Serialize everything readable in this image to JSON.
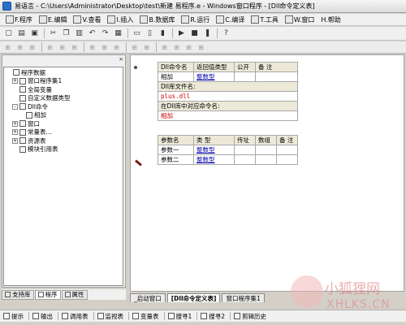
{
  "window": {
    "title": "易语言 - C:\\Users\\Administrator\\Desktop\\test\\新建 易程序.e - Windows窗口程序 - [Dll命令定义表]"
  },
  "menu": [
    {
      "label": "F.程序",
      "icon": "program-icon"
    },
    {
      "label": "E.编辑",
      "icon": "edit-icon"
    },
    {
      "label": "V.查看",
      "icon": "view-icon"
    },
    {
      "label": "I.插入",
      "icon": "insert-icon"
    },
    {
      "label": "B.数据库",
      "icon": "database-icon"
    },
    {
      "label": "R.运行",
      "icon": "run-icon"
    },
    {
      "label": "C.编译",
      "icon": "compile-icon"
    },
    {
      "label": "T.工具",
      "icon": "tools-icon"
    },
    {
      "label": "W.窗口",
      "icon": "window-icon"
    },
    {
      "label": "H.帮助",
      "icon": ""
    }
  ],
  "toolbar": {
    "buttons": [
      "new-file-icon",
      "open-folder-icon",
      "save-icon",
      "cut-icon",
      "copy-icon",
      "paste-icon",
      "undo-icon",
      "redo-icon",
      "find-icon",
      "window-layout-1-icon",
      "window-layout-2-icon",
      "window-layout-3-icon",
      "run-icon",
      "stop-icon",
      "debug-step-icon",
      "help-icon"
    ]
  },
  "toolbar2": {
    "buttons": [
      "align-left-icon",
      "align-center-icon",
      "align-right-icon",
      "align-top-icon",
      "align-middle-icon",
      "align-bottom-icon",
      "same-width-icon",
      "same-height-icon",
      "same-size-icon",
      "space-h-icon",
      "space-v-icon",
      "center-h-icon",
      "center-v-icon",
      "grid-icon",
      "lock-icon"
    ]
  },
  "left_panel": {
    "close_glyph": "×",
    "tree": [
      {
        "label": "程序数据",
        "indent": 0,
        "expander": "",
        "icon": "program-data-icon"
      },
      {
        "label": "窗口程序集1",
        "indent": 1,
        "expander": "+",
        "icon": "assembly-icon"
      },
      {
        "label": "全局变量",
        "indent": 1,
        "expander": "",
        "icon": "global-var-icon"
      },
      {
        "label": "自定义数据类型",
        "indent": 1,
        "expander": "",
        "icon": "custom-type-icon"
      },
      {
        "label": "Dll命令",
        "indent": 1,
        "expander": "-",
        "icon": "dll-command-icon"
      },
      {
        "label": "相加",
        "indent": 2,
        "expander": "",
        "icon": "dll-item-icon"
      },
      {
        "label": "窗口",
        "indent": 1,
        "expander": "+",
        "icon": "window-icon"
      },
      {
        "label": "常量表...",
        "indent": 1,
        "expander": "+",
        "icon": "constant-icon"
      },
      {
        "label": "资源表",
        "indent": 1,
        "expander": "+",
        "icon": "resource-icon"
      },
      {
        "label": "模块引用表",
        "indent": 1,
        "expander": "",
        "icon": "module-ref-icon"
      }
    ],
    "tabs": [
      {
        "label": "支持库",
        "active": false
      },
      {
        "label": "程序",
        "active": true
      },
      {
        "label": "属性",
        "active": false
      }
    ]
  },
  "editor": {
    "dll_table": {
      "headers": [
        "Dll命令名",
        "返回值类型",
        "公开",
        "备 注"
      ],
      "row": [
        "相加",
        "整数型",
        "",
        ""
      ],
      "lib_label": "Dll库文件名:",
      "lib_value": "plus.dll",
      "func_label": "在Dll库中对应命令名:",
      "func_value": "相加",
      "param_headers": [
        "参数名",
        "类 型",
        "传址",
        "数组",
        "备 注"
      ],
      "params": [
        [
          "参数一",
          "整数型",
          "",
          "",
          ""
        ],
        [
          "参数二",
          "整数型",
          "",
          "",
          ""
        ]
      ]
    },
    "tabs": [
      {
        "label": "_启动窗口",
        "active": false
      },
      {
        "label": "[Dll命令定义表]",
        "active": true
      },
      {
        "label": "窗口程序集1",
        "active": false
      }
    ]
  },
  "bottom_bar": [
    {
      "label": "提示",
      "icon": "tip-icon"
    },
    {
      "label": "输出",
      "icon": "output-icon"
    },
    {
      "label": "调用表",
      "icon": "call-table-icon"
    },
    {
      "label": "监视表",
      "icon": "watch-icon"
    },
    {
      "label": "变量表",
      "icon": "variable-icon"
    },
    {
      "label": "搜寻1",
      "icon": "search1-icon"
    },
    {
      "label": "搜寻2",
      "icon": "search2-icon"
    },
    {
      "label": "剪辑历史",
      "icon": "clip-history-icon"
    }
  ],
  "watermark": {
    "text": "小狐狸网",
    "sub": "XHLKS.CN"
  },
  "colors": {
    "type_link": "#0000aa",
    "string": "#cc0000",
    "header_bg": "#ece9d8"
  }
}
